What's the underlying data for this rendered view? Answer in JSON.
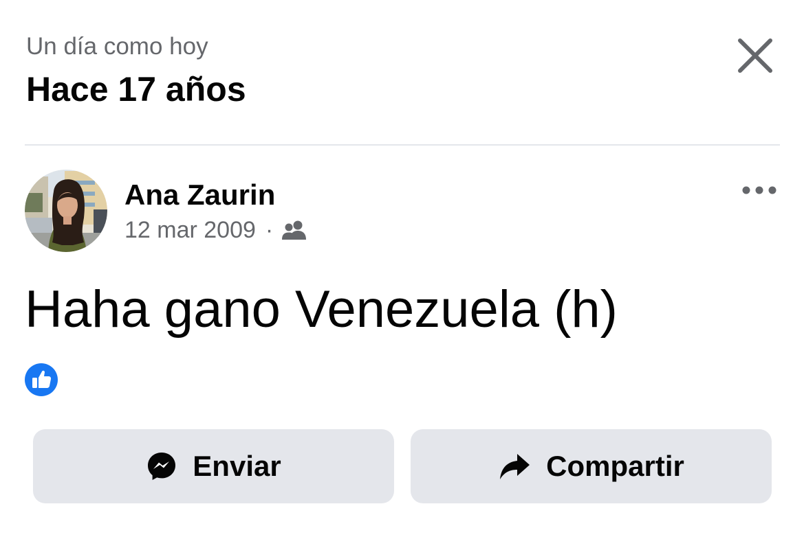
{
  "header": {
    "subtitle": "Un día como hoy",
    "title": "Hace 17 años",
    "close_icon": "close-icon"
  },
  "post": {
    "author": "Ana Zaurin",
    "date": "12 mar 2009",
    "separator": "·",
    "audience_icon": "friends-icon",
    "more_icon": "more-options-icon",
    "text": "Haha gano Venezuela (h)",
    "reaction_icon": "like-icon"
  },
  "actions": {
    "send_label": "Enviar",
    "send_icon": "messenger-icon",
    "share_label": "Compartir",
    "share_icon": "share-icon"
  },
  "colors": {
    "secondary_text": "#65676b",
    "primary_text": "#050505",
    "button_bg": "#e4e6eb",
    "like_blue": "#1877f2"
  }
}
